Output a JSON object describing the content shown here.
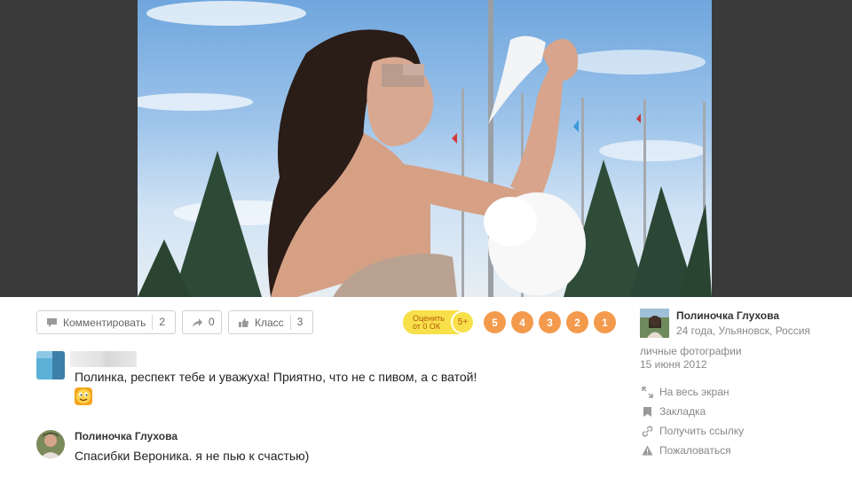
{
  "actions": {
    "comment": {
      "label": "Комментировать",
      "count": "2",
      "icon": "comment-icon"
    },
    "share": {
      "count": "0",
      "icon": "share-arrow-icon"
    },
    "like": {
      "label": "Класс",
      "count": "3",
      "icon": "thumbs-up-icon"
    }
  },
  "rating": {
    "prompt_line1": "Оценить",
    "prompt_line2": "от 0 ОК",
    "plus": "5+",
    "scores": [
      "5",
      "4",
      "3",
      "2",
      "1"
    ],
    "colors": {
      "prompt_bg": "#f7e04a",
      "score_bg": "#f39a4c"
    }
  },
  "comments": [
    {
      "author": "",
      "text": "Полинка, респект тебе и уважуха! Приятно, что не с пивом, а с ватой!",
      "emoji": "smiley-emoji"
    },
    {
      "author": "Полиночка Глухова",
      "text": "Спасибки Вероника. я не пью к счастью)"
    }
  ],
  "author": {
    "name": "Полиночка Глухова",
    "meta": "24 года, Ульяновск, Россия"
  },
  "album": {
    "name": "личные фотографии",
    "date": "15 июня 2012"
  },
  "side_actions": [
    {
      "label": "На весь экран",
      "icon": "fullscreen-icon"
    },
    {
      "label": "Закладка",
      "icon": "bookmark-icon"
    },
    {
      "label": "Получить ссылку",
      "icon": "link-icon"
    },
    {
      "label": "Пожаловаться",
      "icon": "warning-icon"
    }
  ]
}
